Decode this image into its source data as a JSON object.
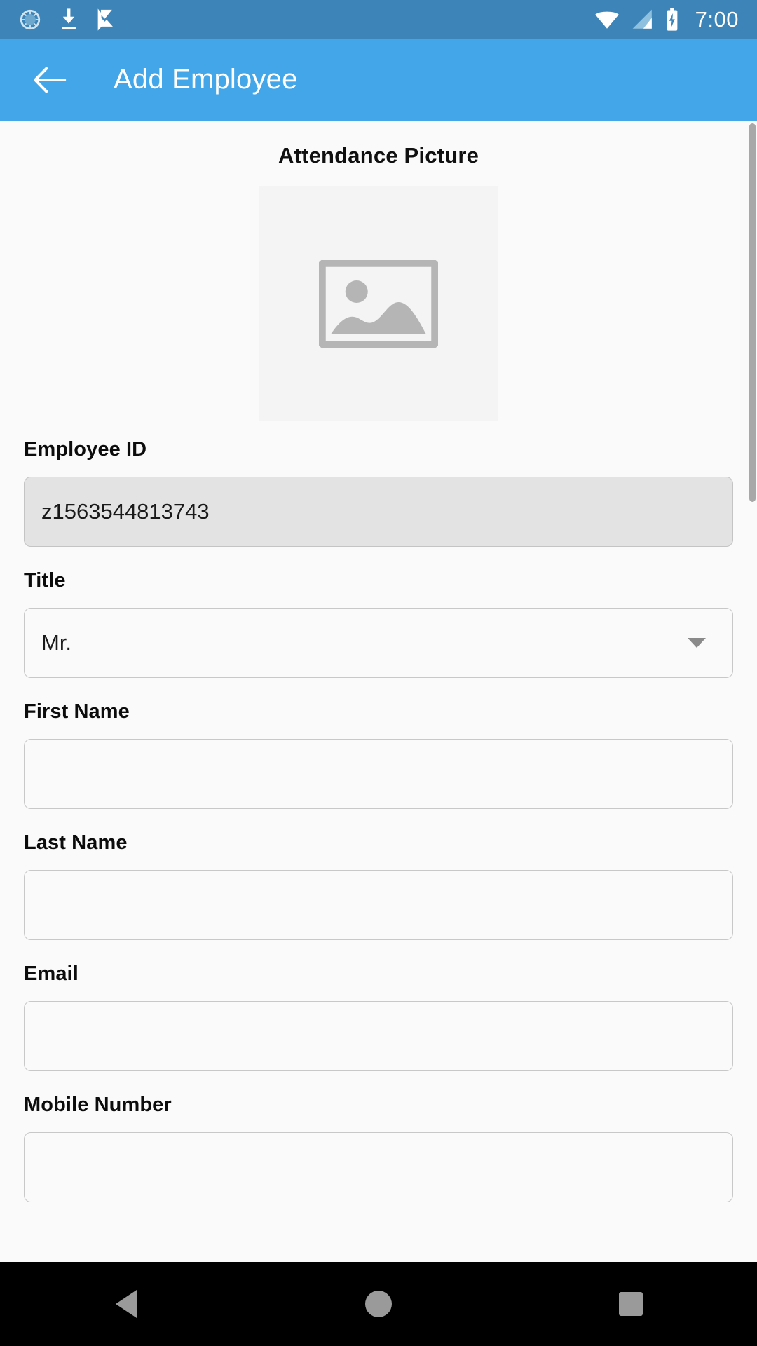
{
  "status_bar": {
    "time": "7:00",
    "left_icons": [
      "settings-sync-icon",
      "download-icon",
      "checkmark-flag-icon"
    ],
    "right_icons": [
      "wifi-icon",
      "cellular-signal-icon",
      "battery-charging-icon"
    ],
    "background_color": "#3d85b8"
  },
  "app_bar": {
    "title": "Add Employee",
    "back_icon": "arrow-left-icon",
    "background_color": "#42a6e8",
    "text_color": "#ffffff"
  },
  "main": {
    "section_title": "Attendance Picture",
    "picture_placeholder_icon": "image-placeholder-icon",
    "fields": [
      {
        "label": "Employee ID",
        "value": "z1563544813743",
        "placeholder": "",
        "type": "text",
        "disabled": true
      },
      {
        "label": "Title",
        "value": "Mr.",
        "placeholder": "",
        "type": "select",
        "disabled": false
      },
      {
        "label": "First Name",
        "value": "",
        "placeholder": "",
        "type": "text",
        "disabled": false
      },
      {
        "label": "Last Name",
        "value": "",
        "placeholder": "",
        "type": "text",
        "disabled": false
      },
      {
        "label": "Email",
        "value": "",
        "placeholder": "",
        "type": "text",
        "disabled": false
      },
      {
        "label": "Mobile Number",
        "value": "",
        "placeholder": "",
        "type": "text",
        "disabled": false
      }
    ]
  },
  "nav_bar": {
    "back_icon": "nav-back-triangle-icon",
    "home_icon": "nav-home-circle-icon",
    "recents_icon": "nav-recents-square-icon",
    "background_color": "#000000"
  }
}
